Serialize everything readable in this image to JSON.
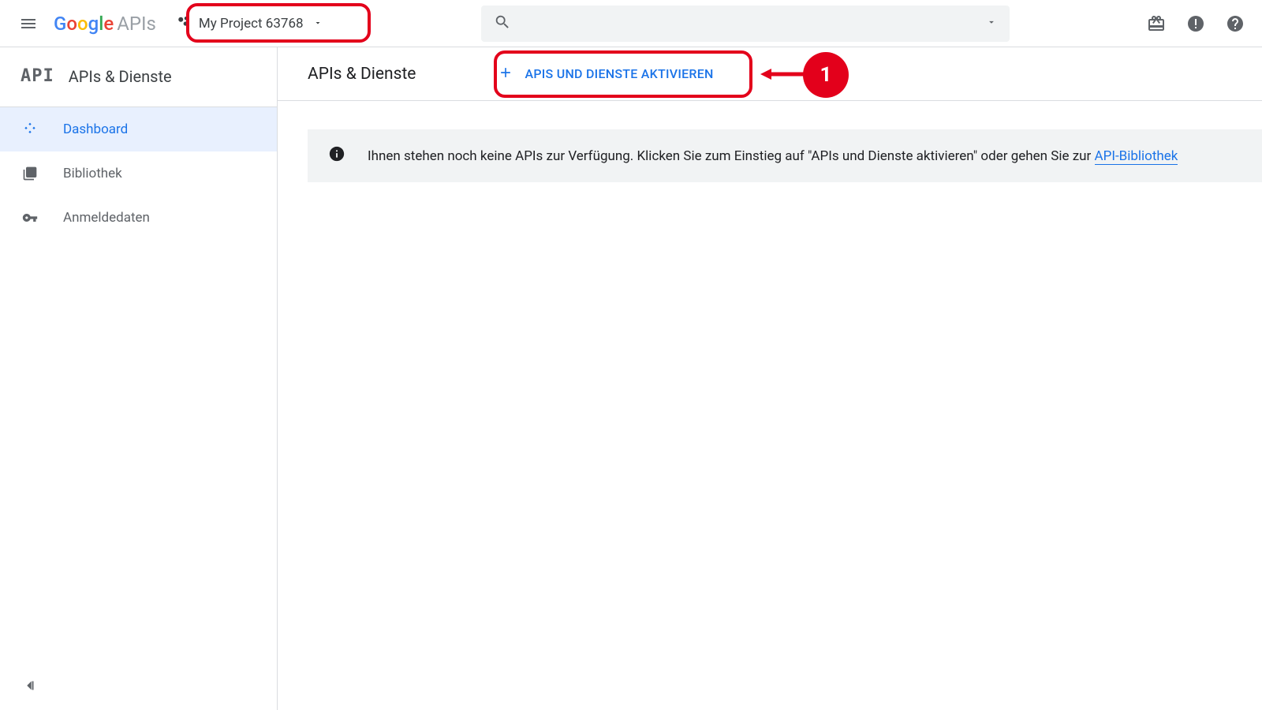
{
  "header": {
    "logo_product": "APIs",
    "project_name": "My Project 63768",
    "search_placeholder": ""
  },
  "sidebar": {
    "section_title": "APIs & Dienste",
    "items": [
      {
        "icon": "dashboard",
        "label": "Dashboard",
        "active": true
      },
      {
        "icon": "library",
        "label": "Bibliothek",
        "active": false
      },
      {
        "icon": "credentials",
        "label": "Anmeldedaten",
        "active": false
      }
    ]
  },
  "main": {
    "title": "APIs & Dienste",
    "activate_button": "APIS UND DIENSTE AKTIVIEREN",
    "info_text_prefix": "Ihnen stehen noch keine APIs zur Verfügung. Klicken Sie zum Einstieg auf \"APIs und Dienste aktivieren\" oder gehen Sie zur ",
    "info_link": "API-Bibliothek"
  },
  "annotation": {
    "badge_number": "1"
  }
}
